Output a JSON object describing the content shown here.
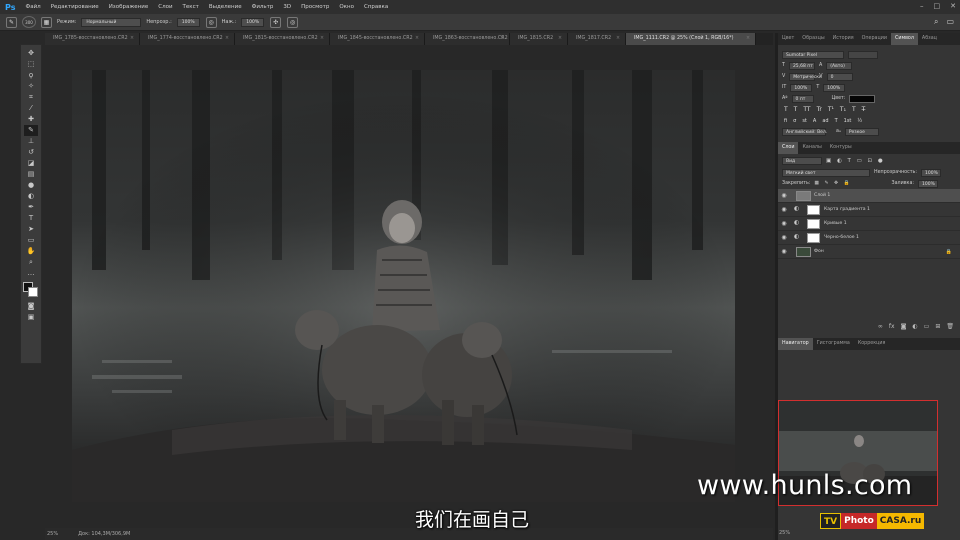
{
  "app": {
    "logo": "Ps"
  },
  "menu": [
    "Файл",
    "Редактирование",
    "Изображение",
    "Слои",
    "Текст",
    "Выделение",
    "Фильтр",
    "3D",
    "Просмотр",
    "Окно",
    "Справка"
  ],
  "options": {
    "brush_size": "300",
    "mode_label": "Режим:",
    "mode_value": "Нормальный",
    "opacity_label": "Непрозр.:",
    "opacity_value": "100%",
    "flow_label": "Наж.:",
    "flow_value": "100%"
  },
  "tabs": [
    "IMG_1785-восстановлено.CR2",
    "IMG_1774-восстановлено.CR2",
    "IMG_1815-восстановлено.CR2",
    "IMG_1845-восстановлено.CR2",
    "IMG_1863-восстановлено.CR2",
    "IMG_1815.CR2",
    "IMG_1817.CR2",
    "IMG_1111.CR2 @ 25% (Слой 1, RGB/16*)"
  ],
  "status": {
    "zoom": "25%",
    "doc": "Док: 104,3M/306,9M"
  },
  "right_panel": {
    "top_tabs": [
      "Цвет",
      "Образцы",
      "История",
      "Операции",
      "Символ",
      "Абзац"
    ],
    "character": {
      "font_family": "Sumotar Pixel",
      "font_size": "25,68 пт",
      "leading": "(Авто)",
      "kerning": "Метрически",
      "tracking": "0",
      "vscale": "100%",
      "hscale": "100%",
      "baseline": "0 пт",
      "color_label": "Цвет:",
      "style_glyphs": [
        "T",
        "T",
        "TT",
        "Tr",
        "T¹",
        "T₁",
        "T",
        "T̶"
      ],
      "opentype_glyphs": [
        "fi",
        "σ",
        "st",
        "A",
        "ad",
        "T",
        "1st",
        "½"
      ],
      "language": "Английский: Вел.",
      "antialias": "Резкое",
      "aa_prefix": "aₐ"
    },
    "layers_tabs": [
      "Слои",
      "Каналы",
      "Контуры"
    ],
    "layers_filter": "Вид",
    "blend_mode": "Мягкий свет",
    "opacity_label": "Непрозрачность:",
    "opacity_value": "100%",
    "lock_label": "Закрепить:",
    "fill_label": "Заливка:",
    "fill_value": "100%",
    "layers": [
      {
        "name": "Слой 1"
      },
      {
        "name": "Карта градиента 1"
      },
      {
        "name": "Кривые 1"
      },
      {
        "name": "Черно-белое 1"
      },
      {
        "name": "Фон"
      }
    ],
    "nav_tabs": [
      "Навигатор",
      "Гистограмма",
      "Коррекция"
    ],
    "nav_zoom": "25%"
  },
  "overlay": {
    "subtitle": "我们在画自己",
    "watermark": "www.hunls.com",
    "logo_tv": "TV",
    "logo_photo": "Photo",
    "logo_casa": "CASA.ru"
  }
}
